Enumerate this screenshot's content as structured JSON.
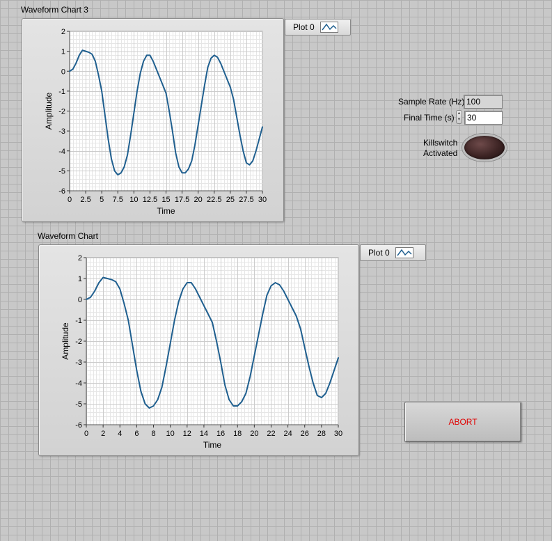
{
  "chart3": {
    "title": "Waveform Chart 3",
    "legend_label": "Plot 0",
    "legend_icon": "line-plot-icon"
  },
  "chart1": {
    "title": "Waveform Chart",
    "legend_label": "Plot 0",
    "legend_icon": "line-plot-icon"
  },
  "controls": {
    "sample_rate_label": "Sample Rate (Hz)",
    "sample_rate_value": "100",
    "final_time_label": "Final Time (s)",
    "final_time_value": "30",
    "killswitch_label_line1": "Killswitch",
    "killswitch_label_line2": "Activated",
    "killswitch_led": "off",
    "abort_label": "ABORT"
  },
  "colors": {
    "plot_line": "#1f5f8f",
    "abort_text": "#e00000"
  },
  "chart_data": [
    {
      "type": "line",
      "title": "Waveform Chart 3",
      "xlabel": "Time",
      "ylabel": "Amplitude",
      "xlim": [
        0,
        30
      ],
      "ylim": [
        -6,
        2
      ],
      "xticks": [
        "0",
        "2.5",
        "5",
        "7.5",
        "10",
        "12.5",
        "15",
        "17.5",
        "20",
        "22.5",
        "25",
        "27.5",
        "30"
      ],
      "yticks": [
        "2",
        "1",
        "0",
        "-1",
        "-2",
        "-3",
        "-4",
        "-5",
        "-6"
      ],
      "grid": true,
      "series": [
        {
          "name": "Plot 0",
          "x": [
            0,
            0.5,
            1,
            1.5,
            2,
            2.5,
            3,
            3.5,
            4,
            4.5,
            5,
            5.5,
            6,
            6.5,
            7,
            7.5,
            8,
            8.5,
            9,
            9.5,
            10,
            10.5,
            11,
            11.5,
            12,
            12.5,
            13,
            13.5,
            14,
            14.5,
            15,
            15.5,
            16,
            16.5,
            17,
            17.5,
            18,
            18.5,
            19,
            19.5,
            20,
            20.5,
            21,
            21.5,
            22,
            22.5,
            23,
            23.5,
            24,
            24.5,
            25,
            25.5,
            26,
            26.5,
            27,
            27.5,
            28,
            28.5,
            29,
            29.5,
            30
          ],
          "values": [
            0,
            0.1,
            0.4,
            0.8,
            1.05,
            1.0,
            0.95,
            0.85,
            0.5,
            -0.2,
            -1.0,
            -2.2,
            -3.4,
            -4.4,
            -5.0,
            -5.2,
            -5.1,
            -4.8,
            -4.2,
            -3.2,
            -2.1,
            -1.0,
            -0.1,
            0.5,
            0.8,
            0.8,
            0.5,
            0.1,
            -0.3,
            -0.7,
            -1.1,
            -2.0,
            -3.0,
            -4.1,
            -4.8,
            -5.1,
            -5.1,
            -4.9,
            -4.5,
            -3.7,
            -2.7,
            -1.7,
            -0.7,
            0.2,
            0.65,
            0.8,
            0.7,
            0.4,
            0.0,
            -0.4,
            -0.8,
            -1.4,
            -2.3,
            -3.2,
            -4.0,
            -4.6,
            -4.7,
            -4.5,
            -4.0,
            -3.4,
            -2.8
          ]
        }
      ]
    },
    {
      "type": "line",
      "title": "Waveform Chart",
      "xlabel": "Time",
      "ylabel": "Amplitude",
      "xlim": [
        0,
        30
      ],
      "ylim": [
        -6,
        2
      ],
      "xticks": [
        "0",
        "2",
        "4",
        "6",
        "8",
        "10",
        "12",
        "14",
        "16",
        "18",
        "20",
        "22",
        "24",
        "26",
        "28",
        "30"
      ],
      "yticks": [
        "2",
        "1",
        "0",
        "-1",
        "-2",
        "-3",
        "-4",
        "-5",
        "-6"
      ],
      "grid": true,
      "series": [
        {
          "name": "Plot 0",
          "x": [
            0,
            0.5,
            1,
            1.5,
            2,
            2.5,
            3,
            3.5,
            4,
            4.5,
            5,
            5.5,
            6,
            6.5,
            7,
            7.5,
            8,
            8.5,
            9,
            9.5,
            10,
            10.5,
            11,
            11.5,
            12,
            12.5,
            13,
            13.5,
            14,
            14.5,
            15,
            15.5,
            16,
            16.5,
            17,
            17.5,
            18,
            18.5,
            19,
            19.5,
            20,
            20.5,
            21,
            21.5,
            22,
            22.5,
            23,
            23.5,
            24,
            24.5,
            25,
            25.5,
            26,
            26.5,
            27,
            27.5,
            28,
            28.5,
            29,
            29.5,
            30
          ],
          "values": [
            0,
            0.1,
            0.4,
            0.8,
            1.05,
            1.0,
            0.95,
            0.85,
            0.5,
            -0.2,
            -1.0,
            -2.2,
            -3.4,
            -4.4,
            -5.0,
            -5.2,
            -5.1,
            -4.8,
            -4.2,
            -3.2,
            -2.1,
            -1.0,
            -0.1,
            0.5,
            0.8,
            0.8,
            0.5,
            0.1,
            -0.3,
            -0.7,
            -1.1,
            -2.0,
            -3.0,
            -4.1,
            -4.8,
            -5.1,
            -5.1,
            -4.9,
            -4.5,
            -3.7,
            -2.7,
            -1.7,
            -0.7,
            0.2,
            0.65,
            0.8,
            0.7,
            0.4,
            0.0,
            -0.4,
            -0.8,
            -1.4,
            -2.3,
            -3.2,
            -4.0,
            -4.6,
            -4.7,
            -4.5,
            -4.0,
            -3.4,
            -2.8
          ]
        }
      ]
    }
  ]
}
